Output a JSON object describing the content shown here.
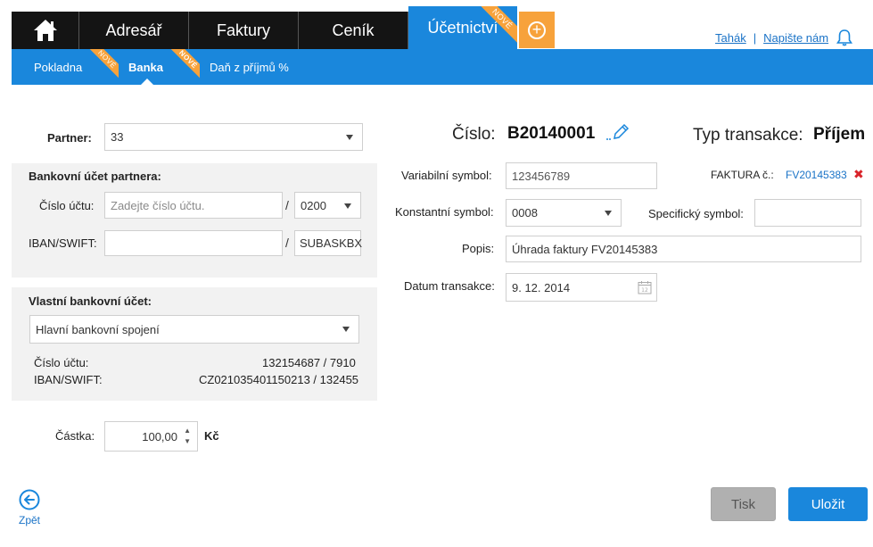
{
  "nav": {
    "tabs": [
      {
        "label": "Adresář"
      },
      {
        "label": "Faktury"
      },
      {
        "label": "Ceník"
      },
      {
        "label": "Účetnictví",
        "badge": "NOVÉ"
      }
    ],
    "home_icon": "home-icon",
    "add_icon": "plus-circle-icon"
  },
  "toplinks": {
    "tahak": "Tahák",
    "separator": "|",
    "napiste": "Napište nám",
    "bell_icon": "bell-icon"
  },
  "subnav": {
    "items": [
      {
        "label": "Pokladna",
        "badge": "NOVÉ"
      },
      {
        "label": "Banka",
        "badge": "NOVÉ"
      },
      {
        "label": "Daň z příjmů %"
      }
    ]
  },
  "form": {
    "partner_label": "Partner:",
    "partner_value": "33",
    "bank_partner_title": "Bankovní účet partnera:",
    "account_label": "Číslo účtu:",
    "account_placeholder": "Zadejte číslo účtu.",
    "slash": "/",
    "bank_code": "0200",
    "iban_label": "IBAN/SWIFT:",
    "iban_value": "",
    "swift_value": "SUBASKBX",
    "own_account_title": "Vlastní bankovní účet:",
    "own_account_value": "Hlavní bankovní spojení",
    "own_account_number_label": "Číslo účtu:",
    "own_account_number": "132154687 / 7910",
    "own_iban_label": "IBAN/SWIFT:",
    "own_iban": "CZ021035401150213 / 132455",
    "amount_label": "Částka:",
    "amount_value": "100,00",
    "currency": "Kč"
  },
  "detail": {
    "cislo_label": "Číslo:",
    "cislo_value": "B20140001",
    "typ_label": "Typ transakce:",
    "typ_value": "Příjem",
    "vs_label": "Variabilní symbol:",
    "vs_value": "123456789",
    "faktura_label": "FAKTURA č.:",
    "faktura_value": "FV20145383",
    "ks_label": "Konstantní symbol:",
    "ks_value": "0008",
    "ss_label": "Specifický symbol:",
    "ss_value": "",
    "popis_label": "Popis:",
    "popis_value": "Úhrada faktury FV20145383",
    "datum_label": "Datum transakce:",
    "datum_value": "9. 12. 2014"
  },
  "buttons": {
    "print": "Tisk",
    "save": "Uložit",
    "back": "Zpět"
  },
  "colors": {
    "accent": "#1a87dc",
    "badge": "#f7a23b",
    "nav_dark": "#141414",
    "remove": "#d9242a"
  }
}
